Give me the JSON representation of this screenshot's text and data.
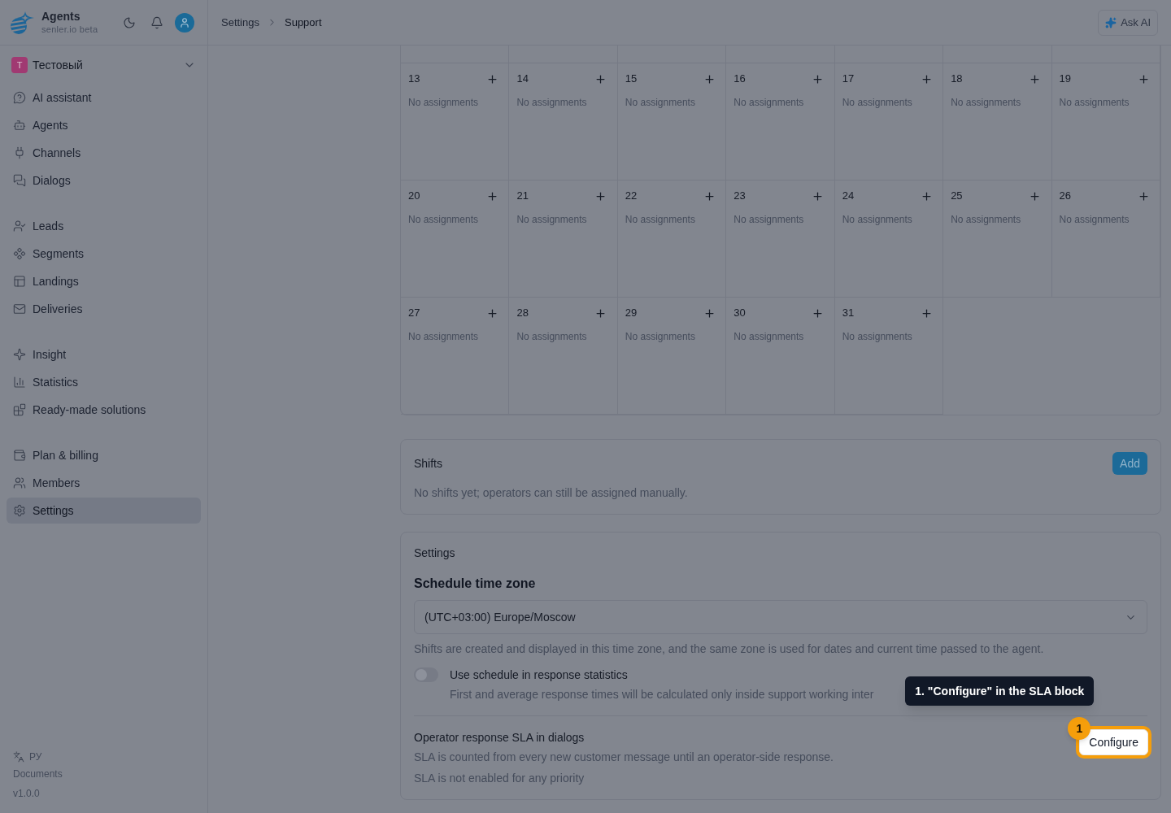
{
  "header": {
    "brand": {
      "name": "Agents",
      "subtitle": "senler.io beta"
    },
    "breadcrumb": [
      "Settings",
      "Support"
    ],
    "ask_ai": "Ask AI"
  },
  "sidebar": {
    "workspace": {
      "initial": "T",
      "name": "Тестовый"
    },
    "groups": [
      [
        {
          "label": "AI assistant",
          "selected": false
        },
        {
          "label": "Agents",
          "selected": false
        },
        {
          "label": "Channels",
          "selected": false
        },
        {
          "label": "Dialogs",
          "selected": false
        }
      ],
      [
        {
          "label": "Leads",
          "selected": false
        },
        {
          "label": "Segments",
          "selected": false
        },
        {
          "label": "Landings",
          "selected": false
        },
        {
          "label": "Deliveries",
          "selected": false
        }
      ],
      [
        {
          "label": "Insight",
          "selected": false
        },
        {
          "label": "Statistics",
          "selected": false
        },
        {
          "label": "Ready-made solutions",
          "selected": false
        }
      ],
      [
        {
          "label": "Plan & billing",
          "selected": false
        },
        {
          "label": "Members",
          "selected": false
        },
        {
          "label": "Settings",
          "selected": true
        }
      ]
    ],
    "footer": {
      "language": "РУ",
      "documents": "Documents",
      "version": "v1.0.0"
    }
  },
  "calendar": {
    "weeks": [
      [
        {
          "day": "13",
          "note": "No assignments"
        },
        {
          "day": "14",
          "note": "No assignments"
        },
        {
          "day": "15",
          "note": "No assignments"
        },
        {
          "day": "16",
          "note": "No assignments"
        },
        {
          "day": "17",
          "note": "No assignments"
        },
        {
          "day": "18",
          "note": "No assignments"
        },
        {
          "day": "19",
          "note": "No assignments"
        }
      ],
      [
        {
          "day": "20",
          "note": "No assignments"
        },
        {
          "day": "21",
          "note": "No assignments"
        },
        {
          "day": "22",
          "note": "No assignments"
        },
        {
          "day": "23",
          "note": "No assignments"
        },
        {
          "day": "24",
          "note": "No assignments"
        },
        {
          "day": "25",
          "note": "No assignments"
        },
        {
          "day": "26",
          "note": "No assignments"
        }
      ],
      [
        {
          "day": "27",
          "note": "No assignments"
        },
        {
          "day": "28",
          "note": "No assignments"
        },
        {
          "day": "29",
          "note": "No assignments"
        },
        {
          "day": "30",
          "note": "No assignments"
        },
        {
          "day": "31",
          "note": "No assignments"
        }
      ]
    ]
  },
  "shifts": {
    "title": "Shifts",
    "add_button": "Add",
    "empty_text": "No shifts yet; operators can still be assigned manually."
  },
  "settings": {
    "title": "Settings",
    "time_zone": {
      "label": "Schedule time zone",
      "value": "(UTC+03:00) Europe/Moscow",
      "hint": "Shifts are created and displayed in this time zone, and the same zone is used for dates and current time passed to the agent."
    },
    "response_statistics": {
      "label": "Use schedule in response statistics",
      "description": "First and average response times will be calculated only inside support working inter",
      "on": false
    },
    "sla": {
      "title": "Operator response SLA in dialogs",
      "description": "SLA is counted from every new customer message until an operator-side response.",
      "status": "SLA is not enabled for any priority",
      "button": "Configure"
    }
  },
  "tour": {
    "step": "1",
    "tooltip": "1. \"Configure\" in the SLA block"
  }
}
